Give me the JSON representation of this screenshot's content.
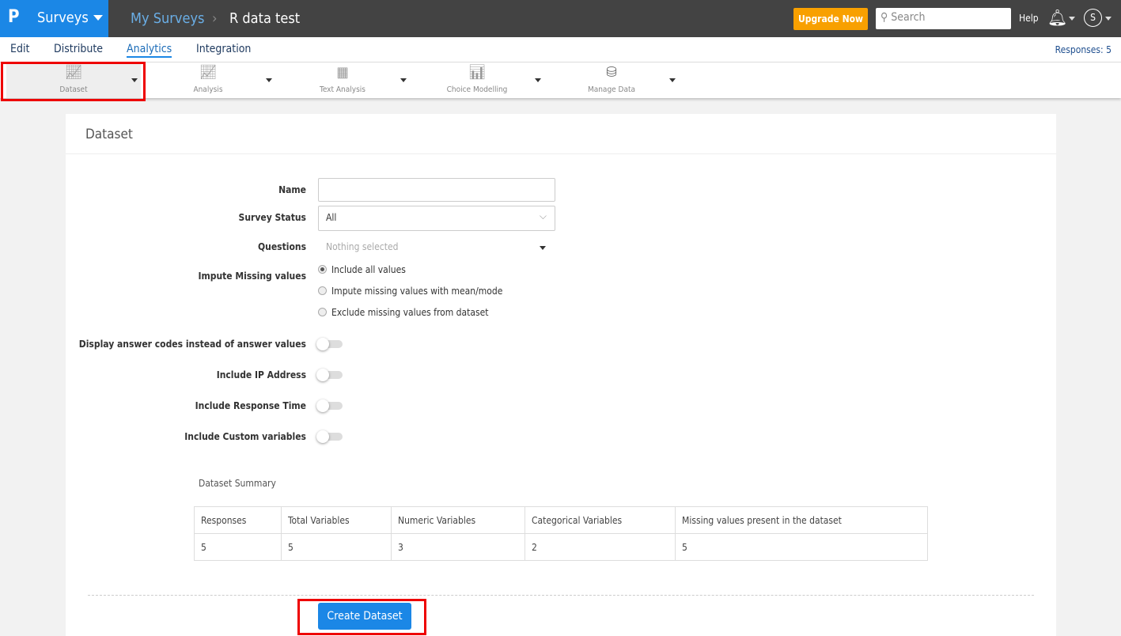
{
  "header": {
    "logo": "P",
    "app": "Surveys",
    "breadcrumb": [
      "My Surveys",
      "R data test"
    ],
    "upgrade": "Upgrade Now",
    "search_placeholder": "Search",
    "help": "Help",
    "avatar": "S"
  },
  "nav": {
    "tabs": [
      "Edit",
      "Distribute",
      "Analytics",
      "Integration"
    ],
    "active": "Analytics",
    "responses": "Responses: 5"
  },
  "toolbar": [
    {
      "label": "Dataset",
      "icon": "line-chart-icon"
    },
    {
      "label": "Analysis",
      "icon": "area-chart-icon"
    },
    {
      "label": "Text Analysis",
      "icon": "document-grid-icon"
    },
    {
      "label": "Choice Modelling",
      "icon": "scatter-bar-icon"
    },
    {
      "label": "Manage Data",
      "icon": "database-icon"
    }
  ],
  "form": {
    "title": "Dataset",
    "name_label": "Name",
    "name_value": "",
    "status_label": "Survey Status",
    "status_value": "All",
    "questions_label": "Questions",
    "questions_placeholder": "Nothing selected",
    "impute_label": "Impute Missing values",
    "impute_options": [
      "Include all values",
      "Impute missing values with mean/mode",
      "Exclude missing values from dataset"
    ],
    "impute_selected": 0,
    "toggles": [
      {
        "label": "Display answer codes instead of answer values",
        "on": false
      },
      {
        "label": "Include IP Address",
        "on": false
      },
      {
        "label": "Include Response Time",
        "on": false
      },
      {
        "label": "Include Custom variables",
        "on": false
      }
    ]
  },
  "summary": {
    "title": "Dataset Summary",
    "headers": [
      "Responses",
      "Total Variables",
      "Numeric Variables",
      "Categorical Variables",
      "Missing values present in the dataset"
    ],
    "values": [
      "5",
      "5",
      "3",
      "2",
      "5"
    ]
  },
  "create_button": "Create Dataset"
}
